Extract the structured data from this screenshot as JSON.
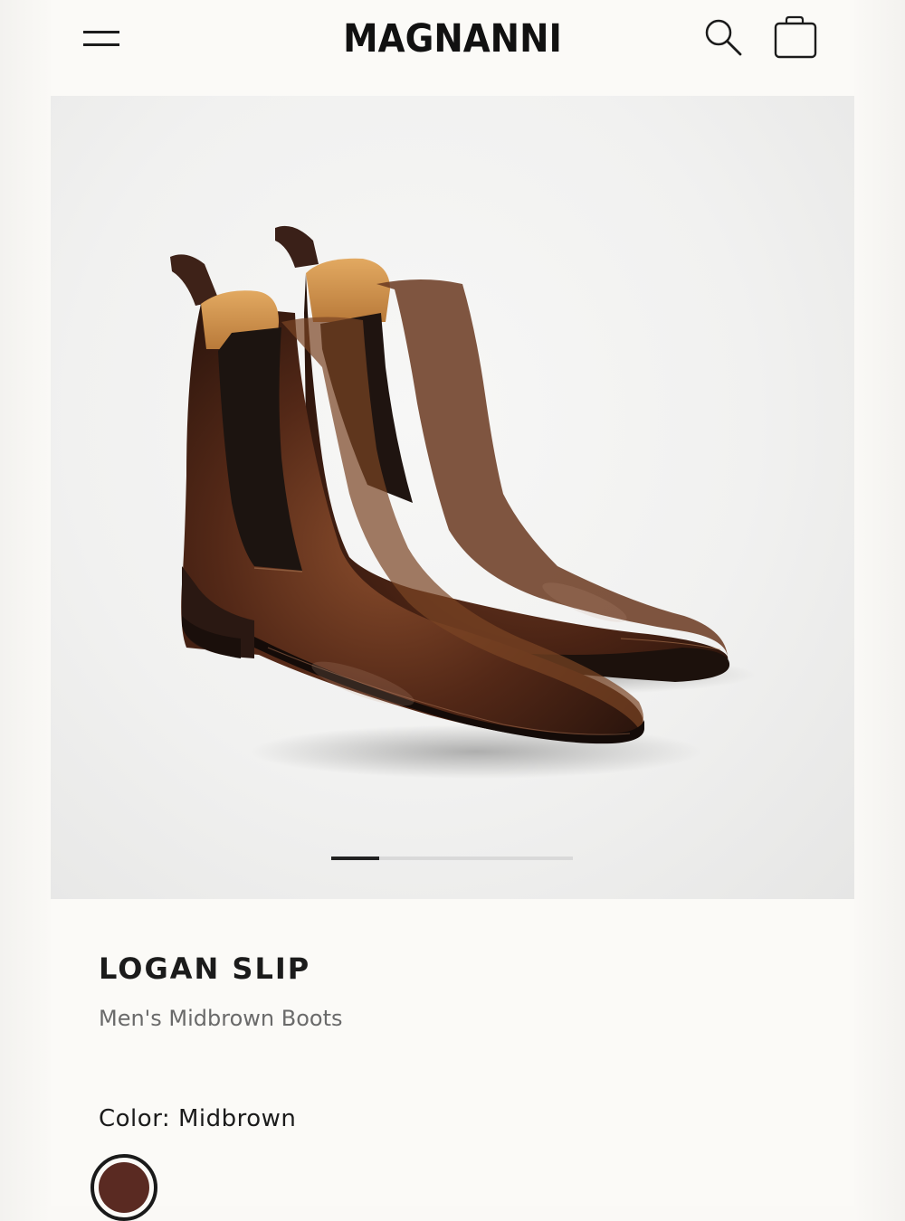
{
  "header": {
    "brand": "MAGNANNI"
  },
  "icons": {
    "menu": "hamburger-menu-icon",
    "search": "search-icon",
    "bag": "shopping-bag-icon"
  },
  "gallery": {
    "image": "brown chelsea boots product photo",
    "slide_progress": 0.2
  },
  "product": {
    "name": "LOGAN SLIP",
    "subtitle": "Men's Midbrown Boots",
    "color_label": "Color: Midbrown",
    "swatch_color": "#5a2a22"
  },
  "colors": {
    "text_primary": "#1b1b1b",
    "text_secondary": "#6a6a6a",
    "leather_dark": "#2b160f",
    "leather_mid": "#5c2e18"
  }
}
